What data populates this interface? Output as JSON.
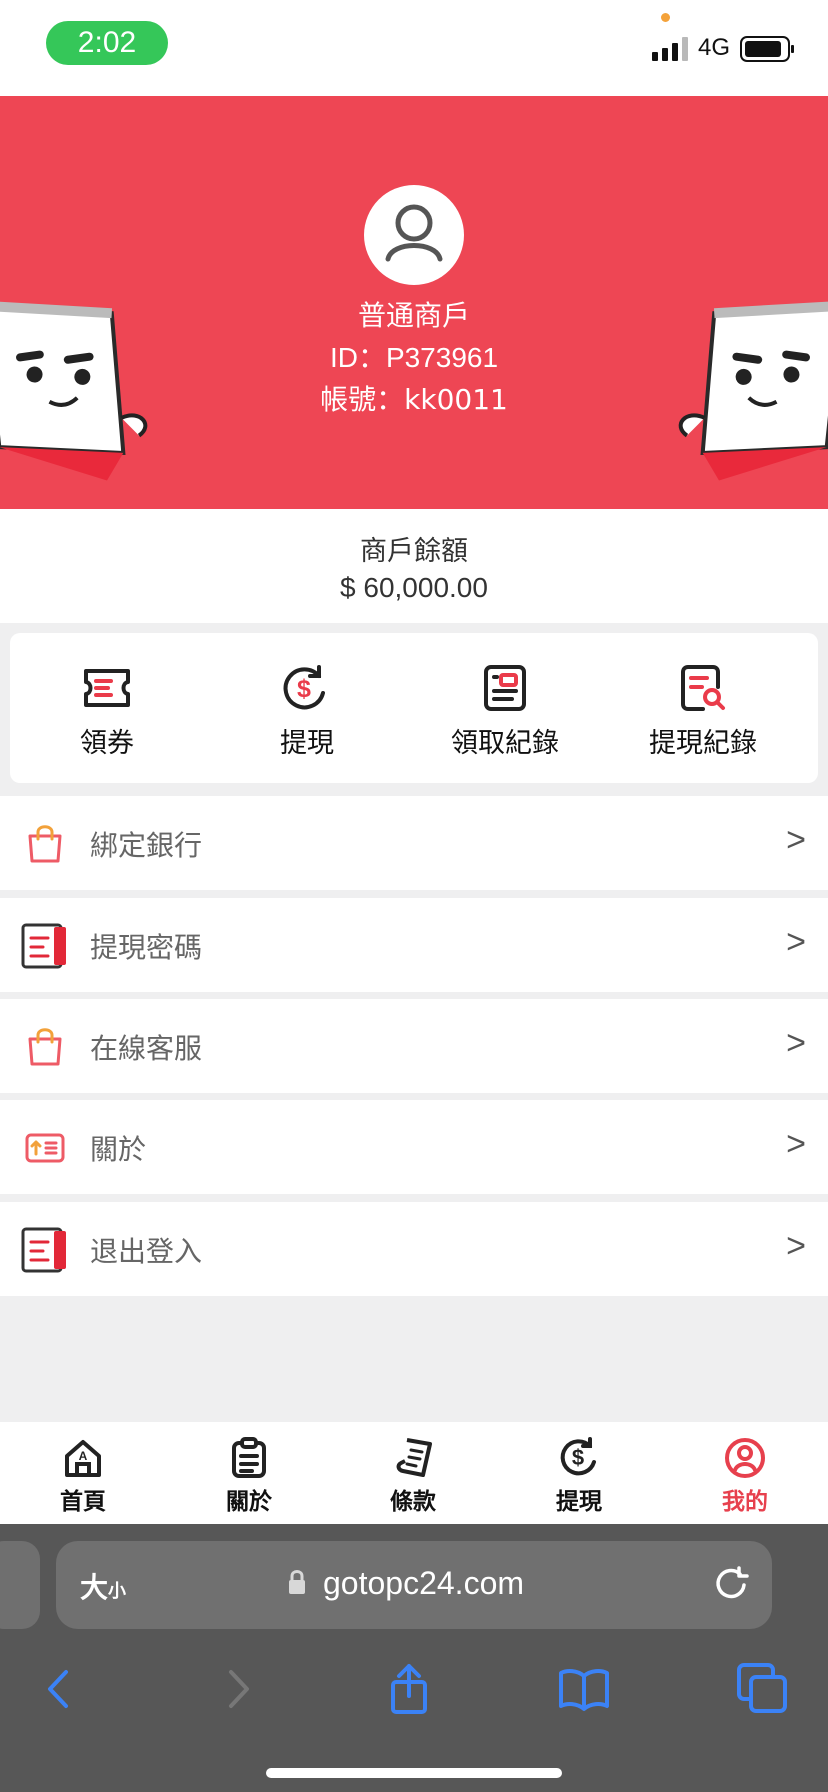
{
  "status_bar": {
    "time": "2:02",
    "network": "4G",
    "colors": {
      "time_pill": "#35c759",
      "dot": "#f4a23a"
    },
    "icons": [
      "signal-icon",
      "battery-icon"
    ]
  },
  "profile": {
    "merchant_type": "普通商戶",
    "id_label": "ID：P373961",
    "account_label": "帳號：kk0011",
    "header_color": "#ee4654",
    "avatar_icon": "user-icon"
  },
  "balance": {
    "label": "商戶餘額",
    "value": "$ 60,000.00"
  },
  "quick_actions": [
    {
      "label": "領券",
      "icon": "ticket-icon"
    },
    {
      "label": "提現",
      "icon": "dollar-icon"
    },
    {
      "label": "領取紀錄",
      "icon": "record-icon"
    },
    {
      "label": "提現紀錄",
      "icon": "search-record-icon"
    }
  ],
  "menu": [
    {
      "label": "綁定銀行",
      "icon": "bag-icon",
      "arrow": ">"
    },
    {
      "label": "提現密碼",
      "icon": "document-icon",
      "arrow": ">"
    },
    {
      "label": "在線客服",
      "icon": "bag-icon",
      "arrow": ">"
    },
    {
      "label": "關於",
      "icon": "info-card-icon",
      "arrow": ">"
    },
    {
      "label": "退出登入",
      "icon": "document-icon",
      "arrow": ">"
    }
  ],
  "bottom_nav": [
    {
      "label": "首頁",
      "icon": "home-icon"
    },
    {
      "label": "關於",
      "icon": "clipboard-icon"
    },
    {
      "label": "條款",
      "icon": "receipt-icon"
    },
    {
      "label": "提現",
      "icon": "dollar-icon"
    },
    {
      "label": "我的",
      "icon": "profile-icon",
      "active": true
    }
  ],
  "browser": {
    "text_size_large": "大",
    "text_size_small": "小",
    "url": "gotopc24.com",
    "icons": [
      "lock-icon",
      "reload-icon",
      "back-icon",
      "forward-icon",
      "share-icon",
      "bookmarks-icon",
      "tabs-icon"
    ],
    "accent": "#3b82f6"
  }
}
